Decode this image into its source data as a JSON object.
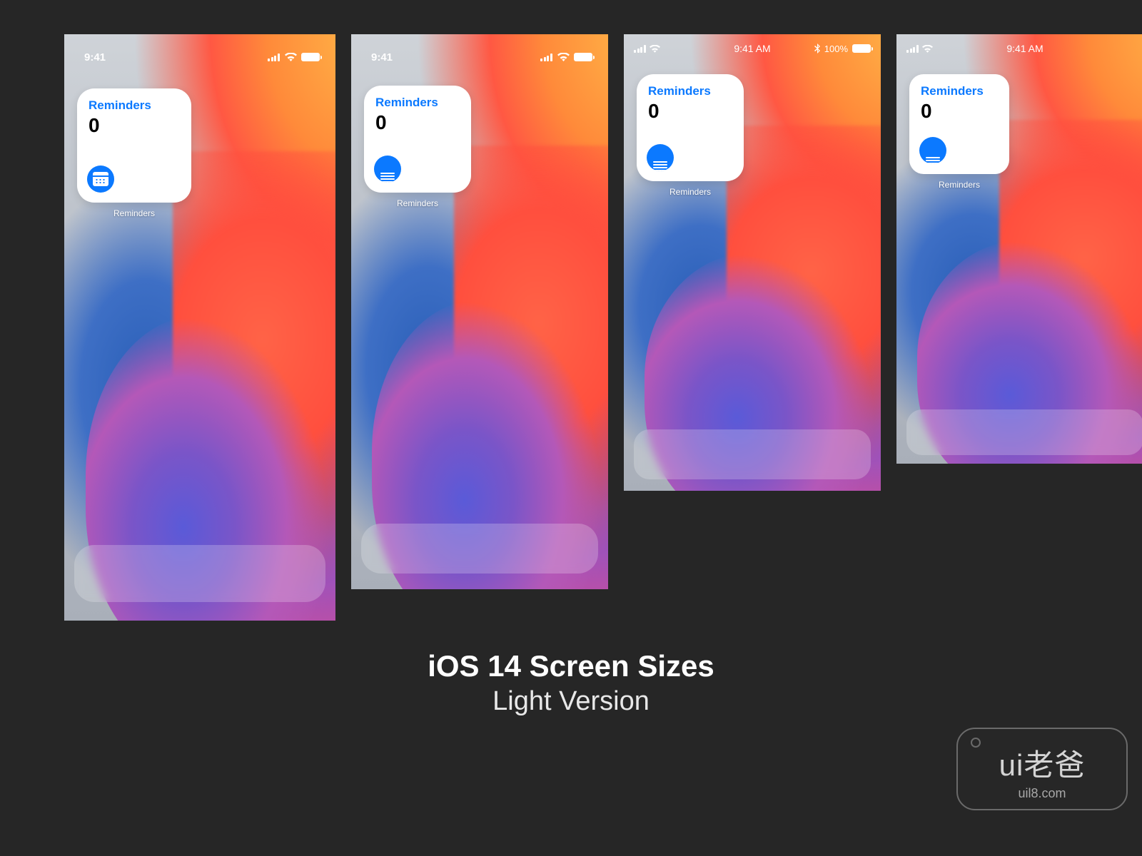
{
  "caption": {
    "line1": "iOS 14 Screen Sizes",
    "line2": "Light Version"
  },
  "watermark": {
    "main": "ui老爸",
    "sub": "uil8.com"
  },
  "phones": [
    {
      "status": {
        "layout": "notch",
        "time": "9:41",
        "rightBattery": "100"
      },
      "widget": {
        "title": "Reminders",
        "count": "0",
        "label": "Reminders",
        "iconStyle": "calendar"
      }
    },
    {
      "status": {
        "layout": "notch",
        "time": "9:41",
        "rightBattery": "100"
      },
      "widget": {
        "title": "Reminders",
        "count": "0",
        "label": "Reminders",
        "iconStyle": "clip"
      }
    },
    {
      "status": {
        "layout": "classic",
        "time": "9:41 AM",
        "battery": "100%"
      },
      "widget": {
        "title": "Reminders",
        "count": "0",
        "label": "Reminders",
        "iconStyle": "clip"
      }
    },
    {
      "status": {
        "layout": "classic-short",
        "time": "9:41 AM",
        "battery": ""
      },
      "widget": {
        "title": "Reminders",
        "count": "0",
        "label": "Reminders",
        "iconStyle": "clip-deep"
      }
    }
  ]
}
